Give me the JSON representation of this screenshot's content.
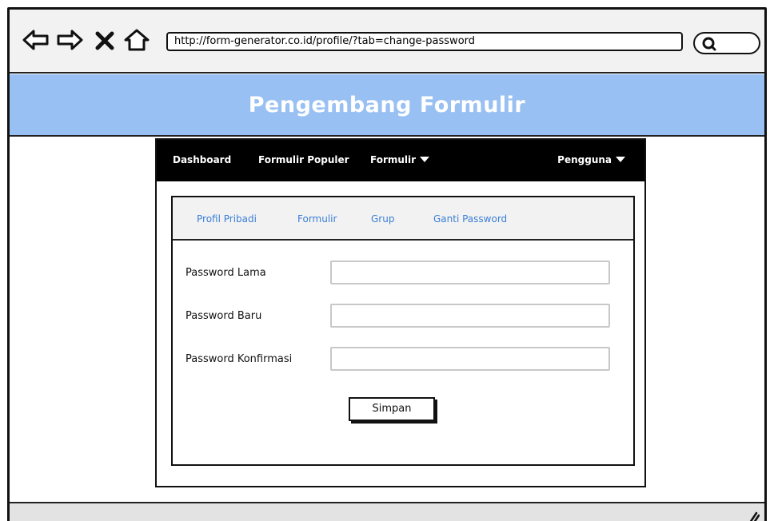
{
  "browser": {
    "url": "http://form-generator.co.id/profile/?tab=change-password",
    "icons": [
      "back-icon",
      "forward-icon",
      "stop-icon",
      "home-icon",
      "search-icon"
    ]
  },
  "header": {
    "title": "Pengembang Formulir",
    "background": "#99c0f2"
  },
  "nav": {
    "items": [
      "Dashboard",
      "Formulir Populer",
      "Formulir",
      "Pengguna"
    ]
  },
  "tabs": {
    "items": [
      "Profil Pribadi",
      "Formulir",
      "Grup",
      "Ganti Password"
    ],
    "color": "#3b7fd6"
  },
  "form": {
    "fields": [
      {
        "label": "Password Lama",
        "value": ""
      },
      {
        "label": "Password Baru",
        "value": ""
      },
      {
        "label": "Password Konfirmasi",
        "value": ""
      }
    ],
    "submit_label": "Simpan"
  }
}
